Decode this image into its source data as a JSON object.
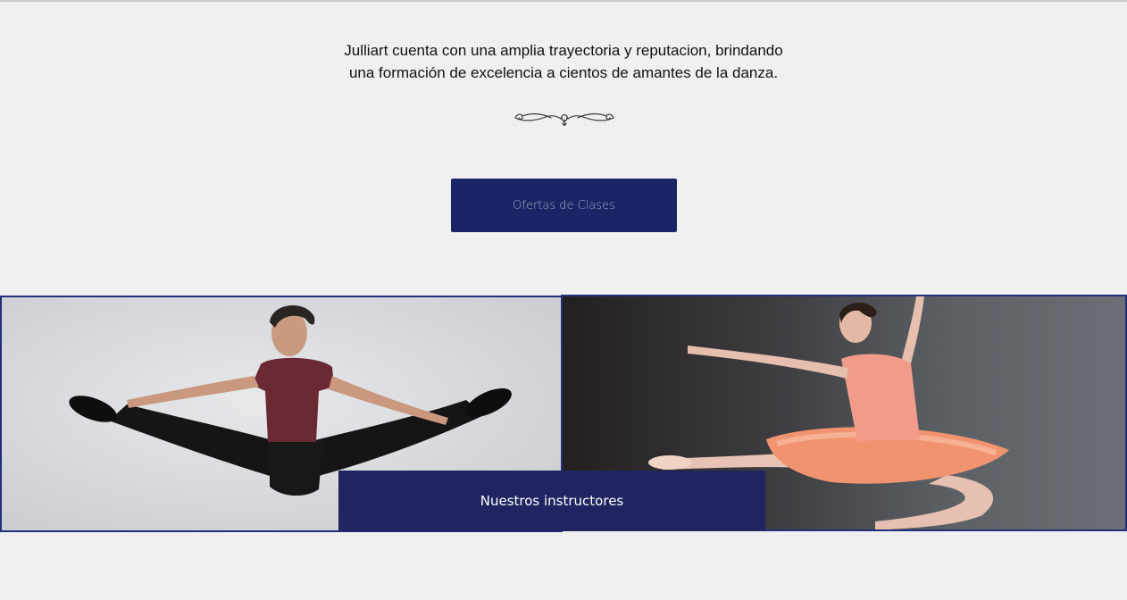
{
  "intro": {
    "line1": "Julliart cuenta con una amplia trayectoria y reputacion, brindando",
    "line2": "una formación de excelencia a cientos de amantes de la danza."
  },
  "divider": {
    "icon": "flourish-ornament-icon"
  },
  "cta": {
    "label": "Ofertas de Clases"
  },
  "gallery": {
    "left_photo": "male-dancer-split-leap-photo",
    "right_photo": "ballerina-tutu-leap-photo",
    "overlay_label": "Nuestros instructores"
  },
  "colors": {
    "accent_navy": "#1b2466",
    "button_text_muted": "#a5a9c4",
    "photo_border": "#232f7e",
    "background": "#f3f3f3"
  }
}
